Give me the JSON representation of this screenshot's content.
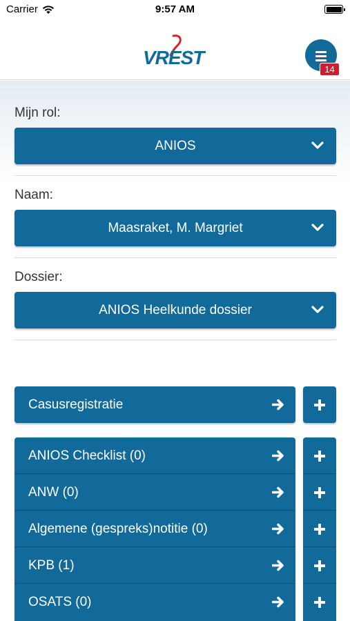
{
  "status_bar": {
    "carrier": "Carrier",
    "time": "9:57 AM"
  },
  "header": {
    "logo_text": "VREST",
    "menu_badge": "14",
    "brand_color": "#126a9a",
    "badge_color": "#cc1f2f"
  },
  "form": {
    "role": {
      "label": "Mijn rol:",
      "value": "ANIOS"
    },
    "name": {
      "label": "Naam:",
      "value": "Maasraket, M. Margriet"
    },
    "dossier": {
      "label": "Dossier:",
      "value": "ANIOS Heelkunde dossier"
    }
  },
  "casus": {
    "label": "Casusregistratie"
  },
  "items": [
    {
      "label": "ANIOS Checklist (0)"
    },
    {
      "label": "ANW (0)"
    },
    {
      "label": "Algemene (gespreks)notitie (0)"
    },
    {
      "label": "KPB (1)"
    },
    {
      "label": "OSATS (0)"
    }
  ]
}
